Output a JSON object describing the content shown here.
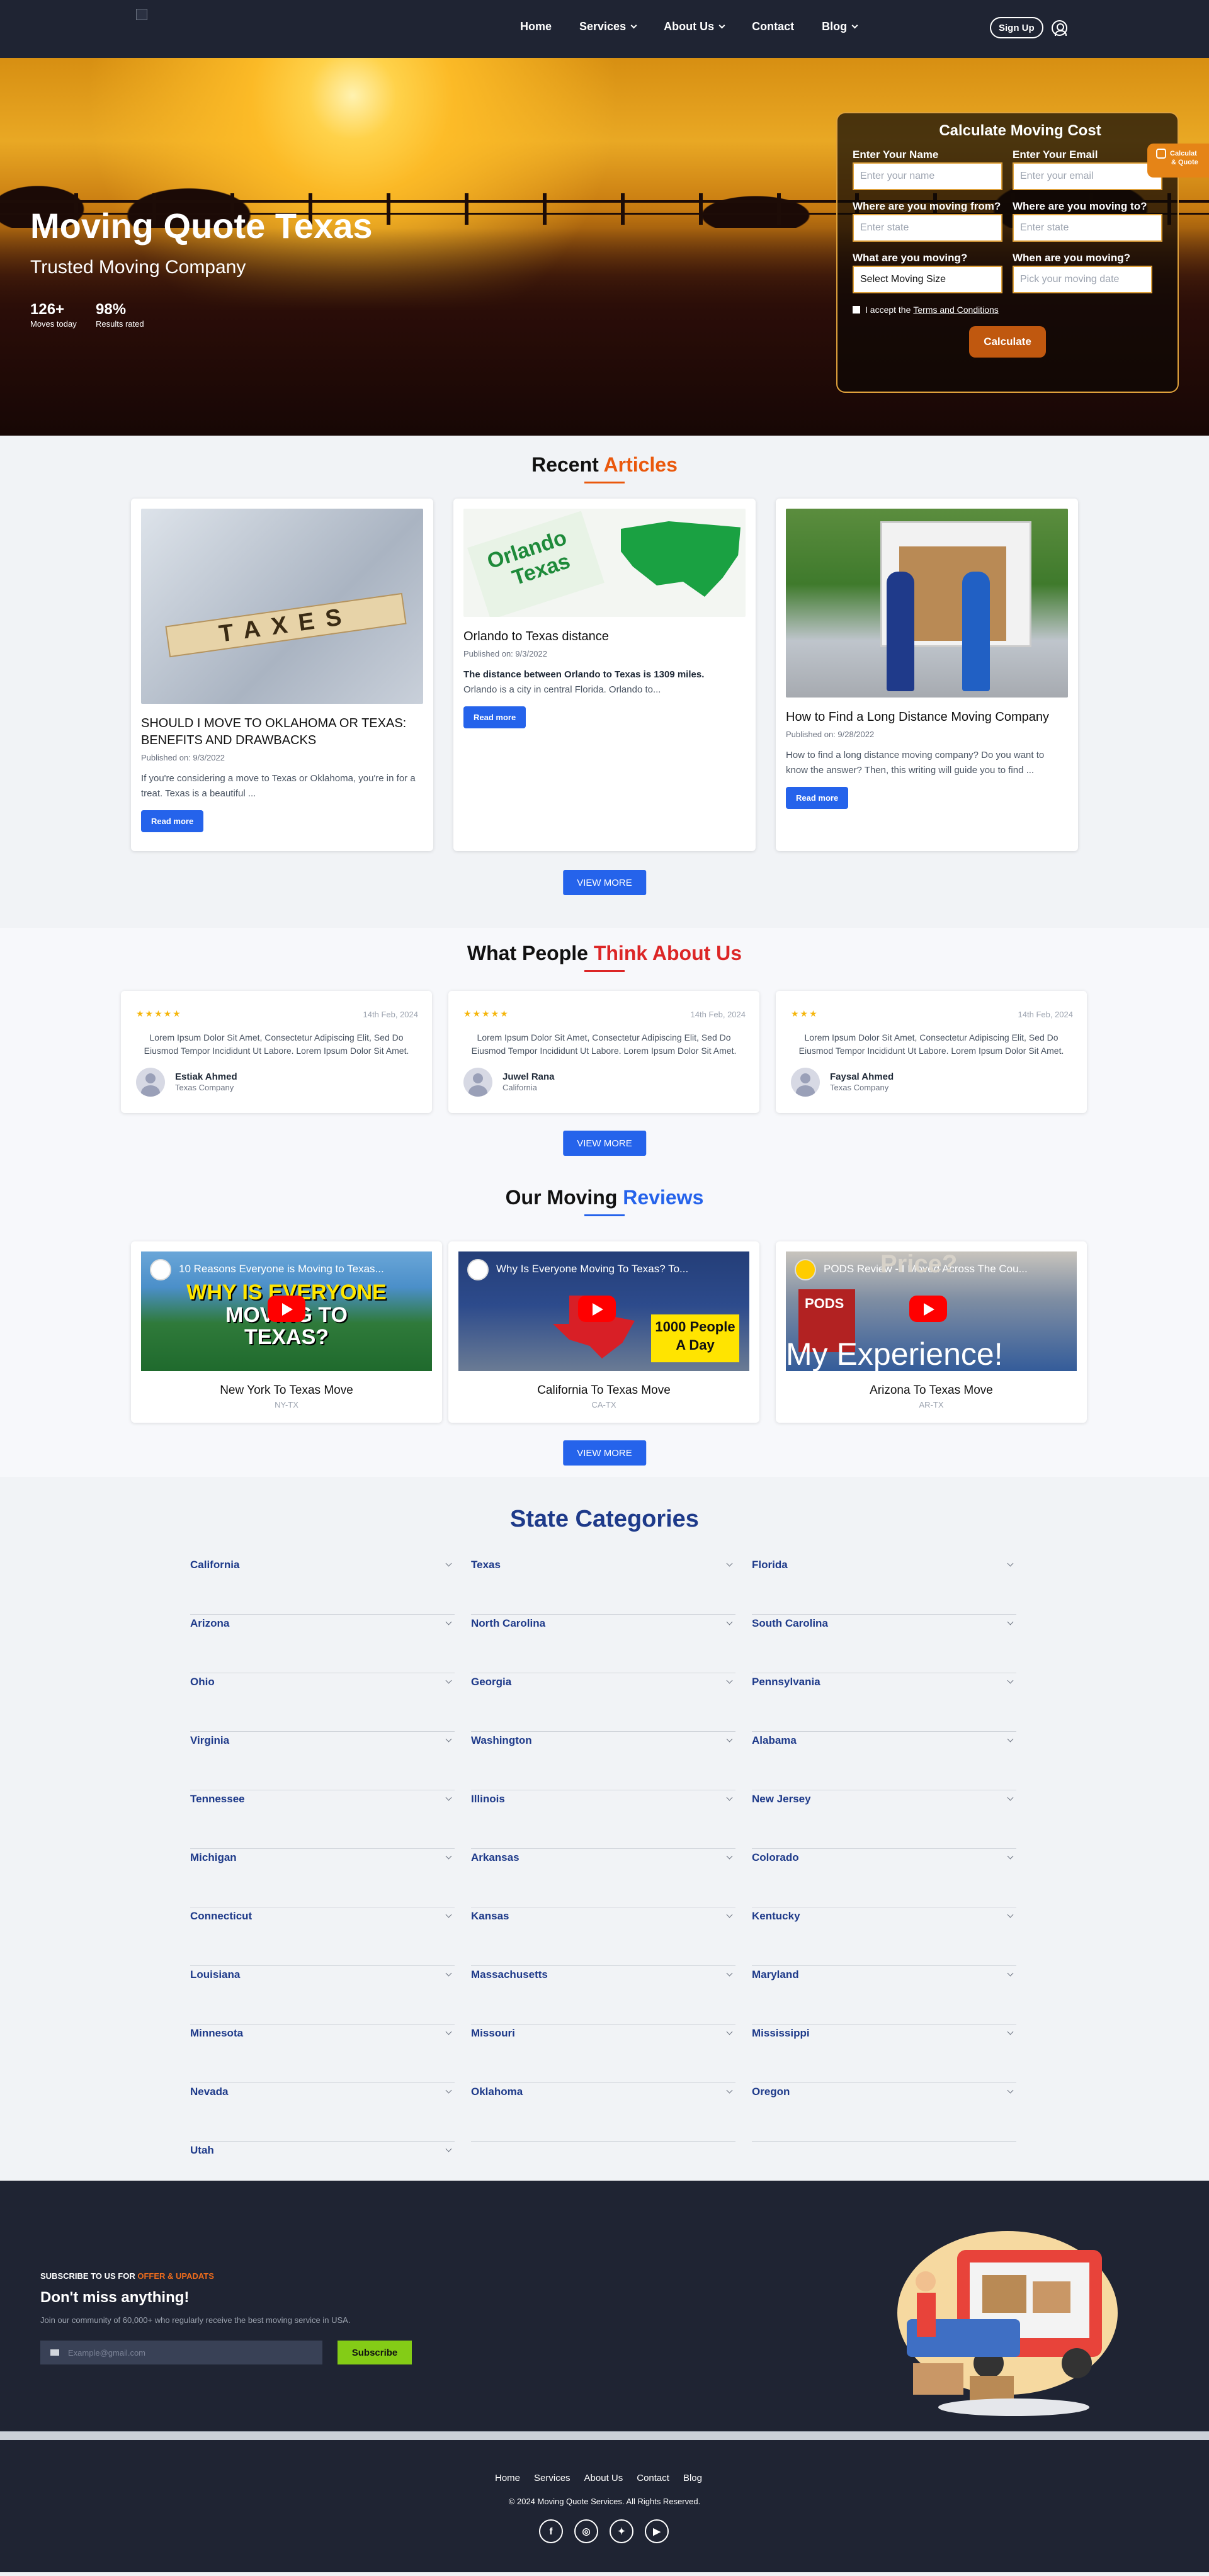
{
  "nav": {
    "links": [
      "Home",
      "Services",
      "About Us",
      "Contact",
      "Blog"
    ],
    "signup": "Sign Up"
  },
  "hero": {
    "title": "Moving Quote Texas",
    "subtitle": "Trusted Moving Company",
    "stats": [
      {
        "value": "126+",
        "label": "Moves today"
      },
      {
        "value": "98%",
        "label": "Results rated"
      }
    ]
  },
  "quote": {
    "title": "Calculate Moving Cost",
    "name_label": "Enter Your Name",
    "name_placeholder": "Enter your name",
    "email_label": "Enter Your Email",
    "email_placeholder": "Enter your email",
    "from_label": "Where are you moving from?",
    "from_placeholder": "Enter state",
    "to_label": "Where are you moving to?",
    "to_placeholder": "Enter state",
    "what_label": "What are you moving?",
    "size_value": "Select Moving Size",
    "when_label": "When are you moving?",
    "date_placeholder": "Pick your moving date",
    "terms_text": "I accept the",
    "terms_link": "Terms and Conditions",
    "button": "Calculate",
    "tab_line1": "Calculat",
    "tab_line2": "& Quote"
  },
  "articles": {
    "title_a": "Recent",
    "title_b": "Articles",
    "accent": "#ea580c",
    "items": [
      {
        "title": "SHOULD I MOVE TO OKLAHOMA OR TEXAS: BENEFITS AND DRAWBACKS",
        "date": "Published on: 9/3/2022",
        "excerpt": "If you're considering a move to Texas or Oklahoma, you're in for a treat. Texas is a beautiful ...",
        "img_text": "TAXES",
        "button": "Read more"
      },
      {
        "title": "Orlando to Texas distance",
        "date": "Published on: 9/3/2022",
        "excerpt_bold": "The distance between Orlando to Texas is 1309 miles.",
        "excerpt": "Orlando is a city in central Florida. Orlando to...",
        "img_text1": "Orlando",
        "img_text2": "Texas",
        "button": "Read more"
      },
      {
        "title": "How to Find a Long Distance Moving Company",
        "date": "Published on: 9/28/2022",
        "excerpt": "How to find a long distance moving company? Do you want to know the answer? Then, this writing will guide you to find ...",
        "button": "Read more"
      }
    ],
    "view_more": "VIEW MORE"
  },
  "testimonials": {
    "title_a": "What People",
    "title_b": "Think About Us",
    "accent": "#dc2626",
    "items": [
      {
        "stars": "★★★★★",
        "date": "14th Feb, 2024",
        "text": "Lorem Ipsum Dolor Sit Amet, Consectetur Adipiscing Elit, Sed Do Eiusmod Tempor Incididunt Ut Labore. Lorem Ipsum Dolor Sit Amet.",
        "name": "Estiak Ahmed",
        "company": "Texas Company"
      },
      {
        "stars": "★★★★★",
        "date": "14th Feb, 2024",
        "text": "Lorem Ipsum Dolor Sit Amet, Consectetur Adipiscing Elit, Sed Do Eiusmod Tempor Incididunt Ut Labore. Lorem Ipsum Dolor Sit Amet.",
        "name": "Juwel Rana",
        "company": "California"
      },
      {
        "stars": "★★★",
        "date": "14th Feb, 2024",
        "text": "Lorem Ipsum Dolor Sit Amet, Consectetur Adipiscing Elit, Sed Do Eiusmod Tempor Incididunt Ut Labore. Lorem Ipsum Dolor Sit Amet.",
        "name": "Faysal Ahmed",
        "company": "Texas Company"
      }
    ],
    "view_more": "VIEW MORE"
  },
  "reviews": {
    "title_a": "Our Moving",
    "title_b": "Reviews",
    "accent": "#2563eb",
    "items": [
      {
        "video_title": "10 Reasons Everyone is Moving to Texas...",
        "caption1": "WHY IS EVERYONE",
        "caption2": "MOVING TO",
        "caption3": "TEXAS?",
        "title": "New York To Texas Move",
        "code": "NY-TX"
      },
      {
        "video_title": "Why Is Everyone Moving To Texas? To...",
        "caption1": "1000 People",
        "caption2": "A Day",
        "title": "California To Texas Move",
        "code": "CA-TX"
      },
      {
        "video_title": "PODS Review - I Moved Across The Cou...",
        "caption1": "PODS",
        "caption2": "Price?",
        "caption3": "My Experience!",
        "title": "Arizona To Texas Move",
        "code": "AR-TX"
      }
    ],
    "view_more": "VIEW MORE"
  },
  "states": {
    "title": "State Categories",
    "items": [
      "California",
      "Texas",
      "Florida",
      "Arizona",
      "North Carolina",
      "South Carolina",
      "Ohio",
      "Georgia",
      "Pennsylvania",
      "Virginia",
      "Washington",
      "Alabama",
      "Tennessee",
      "Illinois",
      "New Jersey",
      "Michigan",
      "Arkansas",
      "Colorado",
      "Connecticut",
      "Kansas",
      "Kentucky",
      "Louisiana",
      "Massachusetts",
      "Maryland",
      "Minnesota",
      "Missouri",
      "Mississippi",
      "Nevada",
      "Oklahoma",
      "Oregon",
      "Utah"
    ]
  },
  "subscribe": {
    "kicker_a": "SUBSCRIBE TO US FOR",
    "kicker_b": "OFFER & UPADATS",
    "title": "Don't miss anything!",
    "text": "Join our community of 60,000+ who regularly receive the best moving service in USA.",
    "email_placeholder": "Example@gmail.com",
    "button": "Subscribe"
  },
  "footer": {
    "links": [
      "Home",
      "Services",
      "About Us",
      "Contact",
      "Blog"
    ],
    "copyright": "© 2024 Moving Quote Services. All Rights Reserved.",
    "social": [
      "facebook-icon",
      "instagram-icon",
      "twitter-icon",
      "youtube-icon"
    ]
  }
}
